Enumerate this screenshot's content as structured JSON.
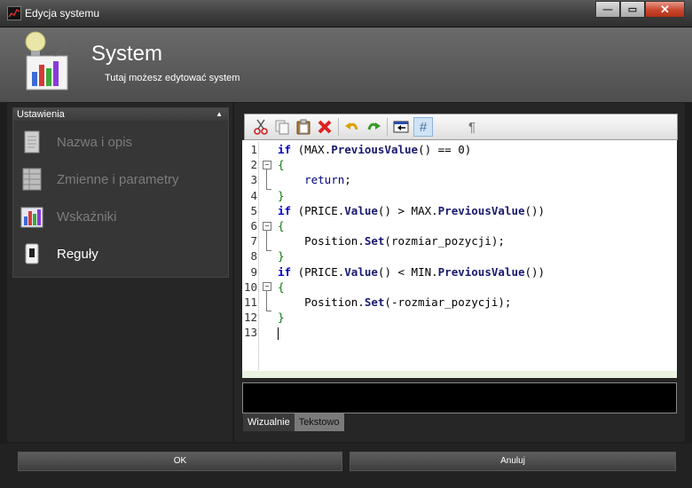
{
  "window": {
    "title": "Edycja systemu"
  },
  "header": {
    "title": "System",
    "subtitle": "Tutaj możesz edytować system"
  },
  "sidebar": {
    "panel_title": "Ustawienia",
    "items": [
      {
        "label": "Nazwa i opis",
        "icon": "document-icon"
      },
      {
        "label": "Zmienne i parametry",
        "icon": "table-icon"
      },
      {
        "label": "Wskaźniki",
        "icon": "bar-chart-icon"
      },
      {
        "label": "Reguły",
        "icon": "rule-icon",
        "active": true
      }
    ]
  },
  "toolbar": {
    "items": [
      "cut-icon",
      "copy-icon",
      "paste-icon",
      "delete-icon",
      "undo-icon",
      "redo-icon",
      "insert-icon",
      "hash-icon",
      "pilcrow-icon"
    ],
    "hash_label": "#",
    "pilcrow_label": "¶"
  },
  "editor": {
    "line_numbers": [
      "1",
      "2",
      "3",
      "4",
      "5",
      "6",
      "7",
      "8",
      "9",
      "10",
      "11",
      "12",
      "13"
    ]
  },
  "bottom_tabs": [
    {
      "label": "Wizualnie"
    },
    {
      "label": "Tekstowo"
    }
  ],
  "buttons": {
    "ok": "OK",
    "cancel": "Anuluj"
  }
}
